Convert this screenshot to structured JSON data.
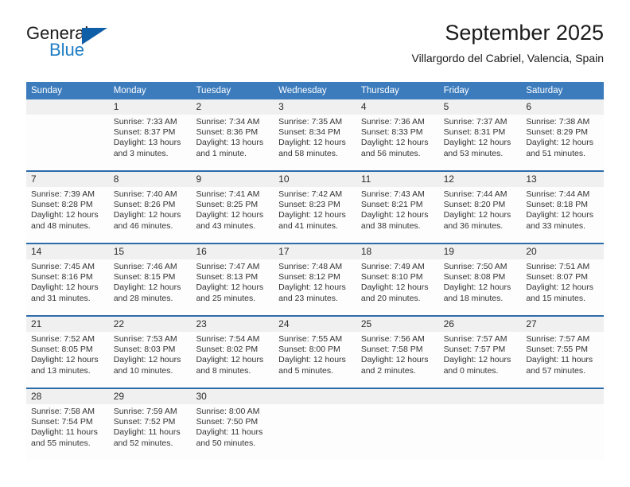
{
  "brand": {
    "name_part1": "General",
    "name_part2": "Blue",
    "triangle_icon": "triangle-icon",
    "accent_color": "#1f7ec4",
    "triangle_color": "#0f5fa8"
  },
  "header": {
    "title": "September 2025",
    "subtitle": "Villargordo del Cabriel, Valencia, Spain"
  },
  "calendar": {
    "header_bg": "#3c7cbd",
    "week_separator_color": "#2d6cab",
    "daynum_bg": "#f0f0f0",
    "weekdays": [
      "Sunday",
      "Monday",
      "Tuesday",
      "Wednesday",
      "Thursday",
      "Friday",
      "Saturday"
    ],
    "weeks": [
      {
        "days": [
          {
            "num": "",
            "sunrise": "",
            "sunset": "",
            "daylight1": "",
            "daylight2": ""
          },
          {
            "num": "1",
            "sunrise": "Sunrise: 7:33 AM",
            "sunset": "Sunset: 8:37 PM",
            "daylight1": "Daylight: 13 hours",
            "daylight2": "and 3 minutes."
          },
          {
            "num": "2",
            "sunrise": "Sunrise: 7:34 AM",
            "sunset": "Sunset: 8:36 PM",
            "daylight1": "Daylight: 13 hours",
            "daylight2": "and 1 minute."
          },
          {
            "num": "3",
            "sunrise": "Sunrise: 7:35 AM",
            "sunset": "Sunset: 8:34 PM",
            "daylight1": "Daylight: 12 hours",
            "daylight2": "and 58 minutes."
          },
          {
            "num": "4",
            "sunrise": "Sunrise: 7:36 AM",
            "sunset": "Sunset: 8:33 PM",
            "daylight1": "Daylight: 12 hours",
            "daylight2": "and 56 minutes."
          },
          {
            "num": "5",
            "sunrise": "Sunrise: 7:37 AM",
            "sunset": "Sunset: 8:31 PM",
            "daylight1": "Daylight: 12 hours",
            "daylight2": "and 53 minutes."
          },
          {
            "num": "6",
            "sunrise": "Sunrise: 7:38 AM",
            "sunset": "Sunset: 8:29 PM",
            "daylight1": "Daylight: 12 hours",
            "daylight2": "and 51 minutes."
          }
        ]
      },
      {
        "days": [
          {
            "num": "7",
            "sunrise": "Sunrise: 7:39 AM",
            "sunset": "Sunset: 8:28 PM",
            "daylight1": "Daylight: 12 hours",
            "daylight2": "and 48 minutes."
          },
          {
            "num": "8",
            "sunrise": "Sunrise: 7:40 AM",
            "sunset": "Sunset: 8:26 PM",
            "daylight1": "Daylight: 12 hours",
            "daylight2": "and 46 minutes."
          },
          {
            "num": "9",
            "sunrise": "Sunrise: 7:41 AM",
            "sunset": "Sunset: 8:25 PM",
            "daylight1": "Daylight: 12 hours",
            "daylight2": "and 43 minutes."
          },
          {
            "num": "10",
            "sunrise": "Sunrise: 7:42 AM",
            "sunset": "Sunset: 8:23 PM",
            "daylight1": "Daylight: 12 hours",
            "daylight2": "and 41 minutes."
          },
          {
            "num": "11",
            "sunrise": "Sunrise: 7:43 AM",
            "sunset": "Sunset: 8:21 PM",
            "daylight1": "Daylight: 12 hours",
            "daylight2": "and 38 minutes."
          },
          {
            "num": "12",
            "sunrise": "Sunrise: 7:44 AM",
            "sunset": "Sunset: 8:20 PM",
            "daylight1": "Daylight: 12 hours",
            "daylight2": "and 36 minutes."
          },
          {
            "num": "13",
            "sunrise": "Sunrise: 7:44 AM",
            "sunset": "Sunset: 8:18 PM",
            "daylight1": "Daylight: 12 hours",
            "daylight2": "and 33 minutes."
          }
        ]
      },
      {
        "days": [
          {
            "num": "14",
            "sunrise": "Sunrise: 7:45 AM",
            "sunset": "Sunset: 8:16 PM",
            "daylight1": "Daylight: 12 hours",
            "daylight2": "and 31 minutes."
          },
          {
            "num": "15",
            "sunrise": "Sunrise: 7:46 AM",
            "sunset": "Sunset: 8:15 PM",
            "daylight1": "Daylight: 12 hours",
            "daylight2": "and 28 minutes."
          },
          {
            "num": "16",
            "sunrise": "Sunrise: 7:47 AM",
            "sunset": "Sunset: 8:13 PM",
            "daylight1": "Daylight: 12 hours",
            "daylight2": "and 25 minutes."
          },
          {
            "num": "17",
            "sunrise": "Sunrise: 7:48 AM",
            "sunset": "Sunset: 8:12 PM",
            "daylight1": "Daylight: 12 hours",
            "daylight2": "and 23 minutes."
          },
          {
            "num": "18",
            "sunrise": "Sunrise: 7:49 AM",
            "sunset": "Sunset: 8:10 PM",
            "daylight1": "Daylight: 12 hours",
            "daylight2": "and 20 minutes."
          },
          {
            "num": "19",
            "sunrise": "Sunrise: 7:50 AM",
            "sunset": "Sunset: 8:08 PM",
            "daylight1": "Daylight: 12 hours",
            "daylight2": "and 18 minutes."
          },
          {
            "num": "20",
            "sunrise": "Sunrise: 7:51 AM",
            "sunset": "Sunset: 8:07 PM",
            "daylight1": "Daylight: 12 hours",
            "daylight2": "and 15 minutes."
          }
        ]
      },
      {
        "days": [
          {
            "num": "21",
            "sunrise": "Sunrise: 7:52 AM",
            "sunset": "Sunset: 8:05 PM",
            "daylight1": "Daylight: 12 hours",
            "daylight2": "and 13 minutes."
          },
          {
            "num": "22",
            "sunrise": "Sunrise: 7:53 AM",
            "sunset": "Sunset: 8:03 PM",
            "daylight1": "Daylight: 12 hours",
            "daylight2": "and 10 minutes."
          },
          {
            "num": "23",
            "sunrise": "Sunrise: 7:54 AM",
            "sunset": "Sunset: 8:02 PM",
            "daylight1": "Daylight: 12 hours",
            "daylight2": "and 8 minutes."
          },
          {
            "num": "24",
            "sunrise": "Sunrise: 7:55 AM",
            "sunset": "Sunset: 8:00 PM",
            "daylight1": "Daylight: 12 hours",
            "daylight2": "and 5 minutes."
          },
          {
            "num": "25",
            "sunrise": "Sunrise: 7:56 AM",
            "sunset": "Sunset: 7:58 PM",
            "daylight1": "Daylight: 12 hours",
            "daylight2": "and 2 minutes."
          },
          {
            "num": "26",
            "sunrise": "Sunrise: 7:57 AM",
            "sunset": "Sunset: 7:57 PM",
            "daylight1": "Daylight: 12 hours",
            "daylight2": "and 0 minutes."
          },
          {
            "num": "27",
            "sunrise": "Sunrise: 7:57 AM",
            "sunset": "Sunset: 7:55 PM",
            "daylight1": "Daylight: 11 hours",
            "daylight2": "and 57 minutes."
          }
        ]
      },
      {
        "days": [
          {
            "num": "28",
            "sunrise": "Sunrise: 7:58 AM",
            "sunset": "Sunset: 7:54 PM",
            "daylight1": "Daylight: 11 hours",
            "daylight2": "and 55 minutes."
          },
          {
            "num": "29",
            "sunrise": "Sunrise: 7:59 AM",
            "sunset": "Sunset: 7:52 PM",
            "daylight1": "Daylight: 11 hours",
            "daylight2": "and 52 minutes."
          },
          {
            "num": "30",
            "sunrise": "Sunrise: 8:00 AM",
            "sunset": "Sunset: 7:50 PM",
            "daylight1": "Daylight: 11 hours",
            "daylight2": "and 50 minutes."
          },
          {
            "num": "",
            "sunrise": "",
            "sunset": "",
            "daylight1": "",
            "daylight2": ""
          },
          {
            "num": "",
            "sunrise": "",
            "sunset": "",
            "daylight1": "",
            "daylight2": ""
          },
          {
            "num": "",
            "sunrise": "",
            "sunset": "",
            "daylight1": "",
            "daylight2": ""
          },
          {
            "num": "",
            "sunrise": "",
            "sunset": "",
            "daylight1": "",
            "daylight2": ""
          }
        ]
      }
    ]
  }
}
